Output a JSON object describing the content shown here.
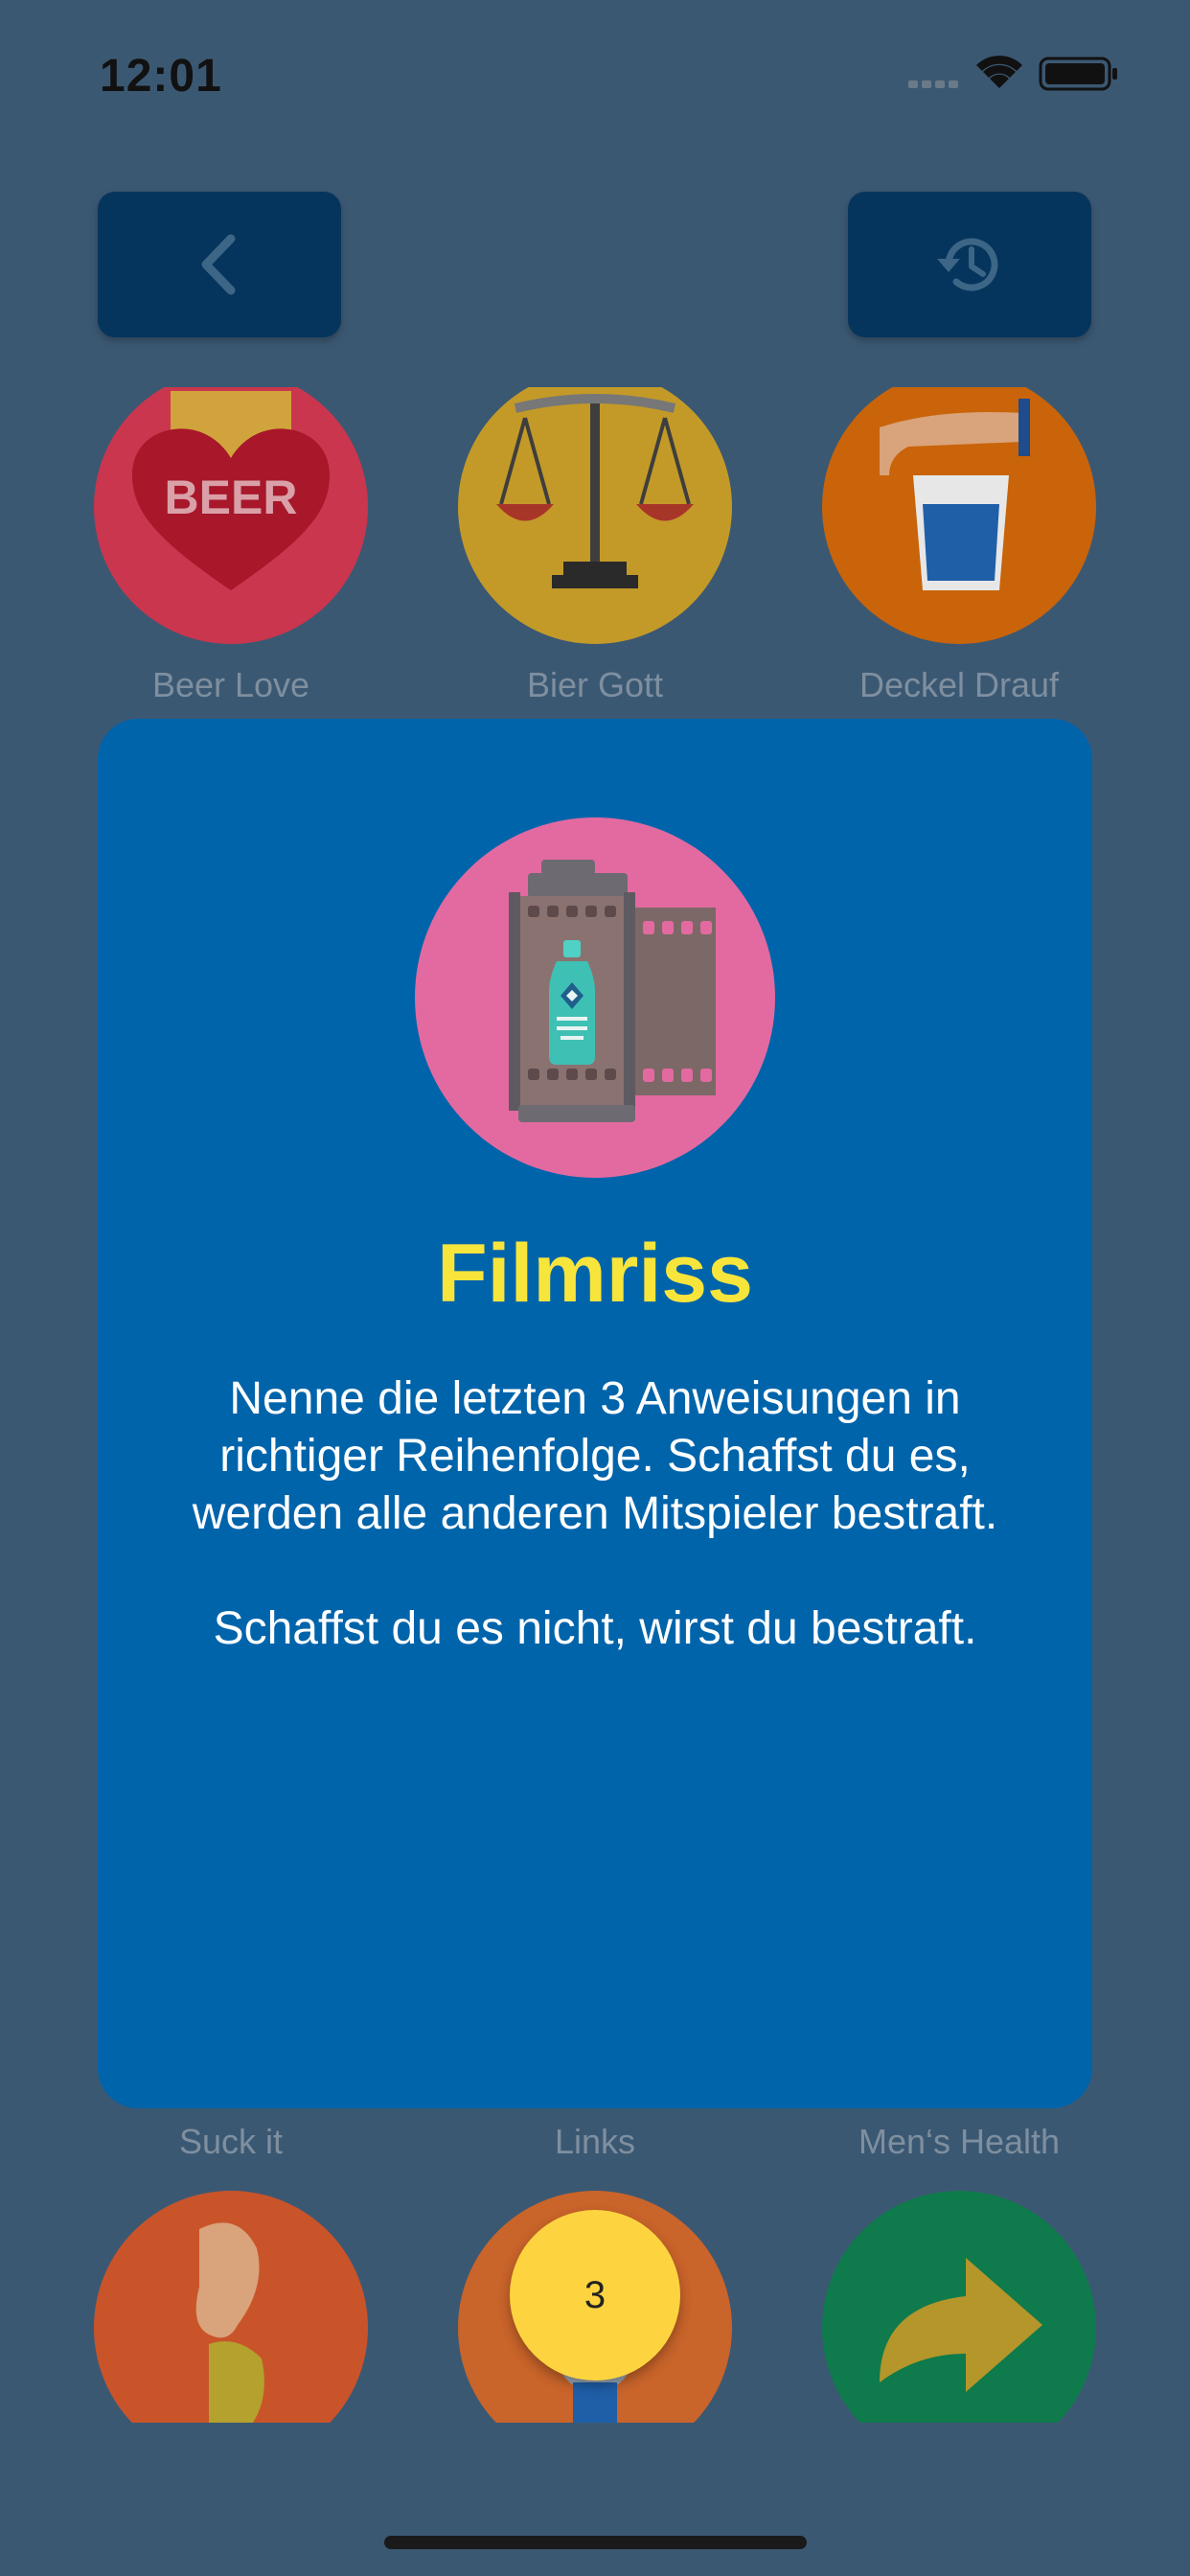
{
  "status_bar": {
    "time": "12:01"
  },
  "nav": {
    "back_icon": "chevron-left-icon",
    "history_icon": "history-icon"
  },
  "games_top": [
    {
      "label": "Beer Love",
      "icon": "beer-heart-icon",
      "color": "#c9364e"
    },
    {
      "label": "Bier Gott",
      "icon": "scales-icon",
      "color": "#c39a28"
    },
    {
      "label": "Deckel Drauf",
      "icon": "hand-glass-icon",
      "color": "#c9640a"
    }
  ],
  "games_bottom": [
    {
      "label": "Suck it",
      "icon": "ear-hand-icon",
      "color": "#c9542a"
    },
    {
      "label": "Links",
      "icon": "person-icon",
      "color": "#c9642a"
    },
    {
      "label": "Men‘s Health",
      "icon": "arrow-right-icon",
      "color": "#0f7a4c"
    }
  ],
  "modal": {
    "icon": "film-roll-bottle-icon",
    "title": "Filmriss",
    "text": "Nenne die letzten 3 Anweisungen in richtiger Reihenfolge. Schaffst du es, werden alle anderen Mitspieler bestraft.\n\nSchaffst du es nicht, wirst du bestraft."
  },
  "timer": {
    "value": "3"
  },
  "colors": {
    "background": "#3b5873",
    "modal": "#0064ab",
    "title": "#f8e53b",
    "timer": "#fdd43f",
    "button": "#05355c"
  }
}
